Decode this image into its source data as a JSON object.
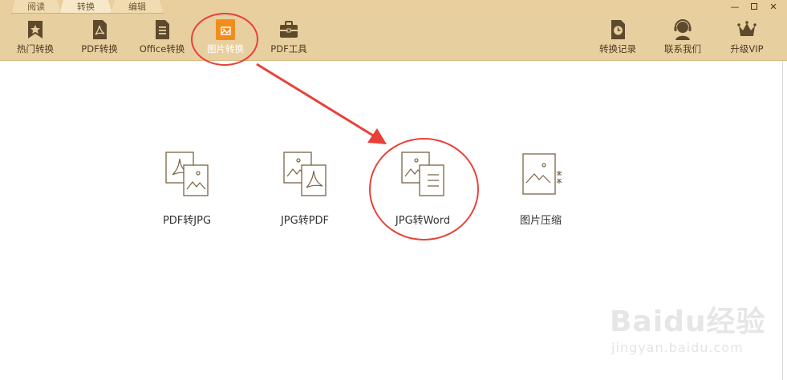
{
  "mode_tabs": [
    {
      "label": "阅读"
    },
    {
      "label": "转换"
    },
    {
      "label": "编辑"
    }
  ],
  "window_controls": {
    "minimize_icon": "minimize-icon",
    "maximize_icon": "maximize-icon",
    "close_icon": "close-icon"
  },
  "toolbar": {
    "left_items": [
      {
        "label": "热门转换",
        "icon": "star-icon"
      },
      {
        "label": "PDF转换",
        "icon": "pdf-file-icon"
      },
      {
        "label": "Office转换",
        "icon": "office-file-icon"
      },
      {
        "label": "图片转换",
        "icon": "image-file-icon",
        "active": true
      },
      {
        "label": "PDF工具",
        "icon": "toolbox-icon"
      }
    ],
    "right_items": [
      {
        "label": "转换记录",
        "icon": "history-clock-icon"
      },
      {
        "label": "联系我们",
        "icon": "headset-icon"
      },
      {
        "label": "升级VIP",
        "icon": "crown-icon"
      }
    ],
    "active_color": "#f08d1d",
    "bg_color": "#e8cf9f"
  },
  "features": [
    {
      "label": "PDF转JPG",
      "icon": "pdf-to-jpg-icon"
    },
    {
      "label": "JPG转PDF",
      "icon": "jpg-to-pdf-icon"
    },
    {
      "label": "JPG转Word",
      "icon": "jpg-to-word-icon"
    },
    {
      "label": "图片压缩",
      "icon": "image-compress-icon"
    }
  ],
  "annotation_color": "#e8413a",
  "watermark": {
    "brand": "Baidu经验",
    "url": "jingyan.baidu.com"
  }
}
